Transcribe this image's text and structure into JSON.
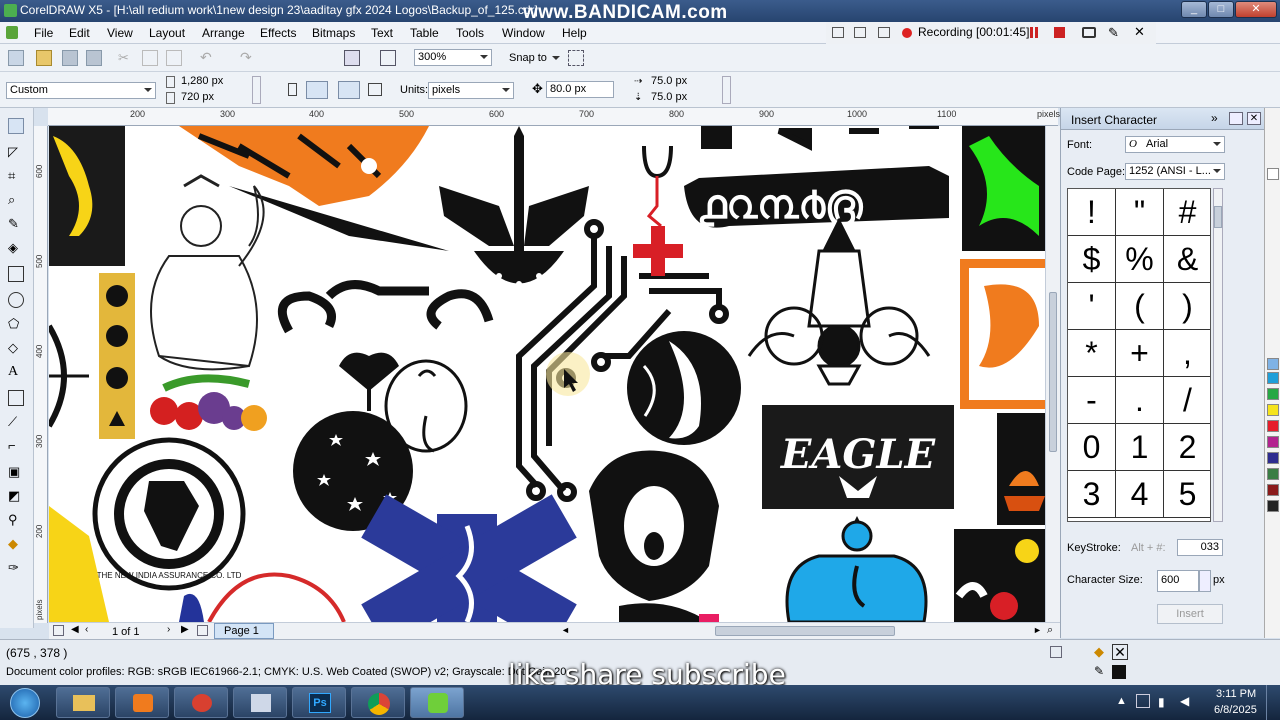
{
  "titlebar": {
    "title": "CorelDRAW X5 - [H:\\all redium work\\1new design 23\\aaditay gfx 2024 Logos\\Backup_of_125.cdr]",
    "watermark": "www.BANDICAM.com",
    "minimize": "_",
    "restore": "□",
    "close": "✕"
  },
  "recording": {
    "text": "Recording [00:01:45]"
  },
  "menu": {
    "items": [
      "File",
      "Edit",
      "View",
      "Layout",
      "Arrange",
      "Effects",
      "Bitmaps",
      "Text",
      "Table",
      "Tools",
      "Window",
      "Help"
    ]
  },
  "toolbar": {
    "zoom": "300%",
    "snap_to": "Snap to"
  },
  "property_bar": {
    "preset": "Custom",
    "width": "1,280 px",
    "height": "720 px",
    "units_label": "Units:",
    "units": "pixels",
    "nudge": "80.0 px",
    "dup_x": "75.0 px",
    "dup_y": "75.0 px"
  },
  "ruler": {
    "top_ticks": [
      "200",
      "300",
      "400",
      "500",
      "600",
      "700",
      "800",
      "900",
      "1000",
      "1100"
    ],
    "top_unit": "pixels",
    "left_ticks": [
      "600",
      "500",
      "400",
      "300",
      "200"
    ],
    "left_unit": "pixels"
  },
  "canvas": {
    "logo_texts": {
      "eagle": "EAGLE",
      "india_ring": "THE NEW INDIA ASSURANCE CO. LTD"
    }
  },
  "docker": {
    "title": "Insert Character",
    "font_label": "Font:",
    "font": "Arial",
    "codepage_label": "Code Page:",
    "codepage": "1252  (ANSI - L...",
    "chars": [
      "!",
      "\"",
      "#",
      "$",
      "%",
      "&",
      "'",
      "(",
      ")",
      "*",
      "+",
      ",",
      "-",
      ".",
      "/",
      "0",
      "1",
      "2",
      "3",
      "4",
      "5"
    ],
    "keystroke_label": "KeyStroke:",
    "keystroke_hint": "Alt + #:",
    "keystroke_value": "033",
    "charsize_label": "Character Size:",
    "charsize_value": "600",
    "charsize_unit": "px",
    "insert_button": "Insert"
  },
  "pagebar": {
    "page_of": "1 of 1",
    "page_tab": "Page 1"
  },
  "status": {
    "coords": "(675 , 378 )",
    "color_profiles": "Document color profiles: RGB: sRGB IEC61966-2.1; CMYK: U.S. Web Coated (SWOP) v2; Grayscale: Dot Gain 20"
  },
  "overlay": {
    "subtitle": "like share subscribe"
  },
  "taskbar": {
    "time": "3:11 PM",
    "date": "6/8/2025"
  },
  "colors": {
    "title_bg": "#27446f",
    "accent_orange": "#f07b1e",
    "eagle_bg": "#1a1a1a",
    "star_of_life": "#2b3a9a",
    "ganesha_blue": "#1fa8e8",
    "red_cross": "#e0202a"
  }
}
